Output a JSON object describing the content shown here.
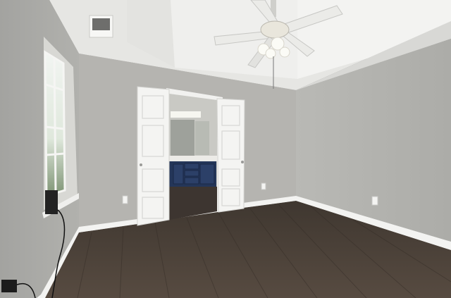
{
  "scene": {
    "kind": "photo",
    "room": "empty bedroom",
    "palette": {
      "ceiling": "#ececea",
      "wall_left": "#a9a9a6",
      "wall_back": "#b7b6b2",
      "wall_right": "#b4b4b0",
      "floor": "#4a4038",
      "baseboard": "#f3f3f1",
      "door": "#f4f4f2",
      "vanity": "#243659",
      "fan_blade": "#ececea"
    }
  }
}
